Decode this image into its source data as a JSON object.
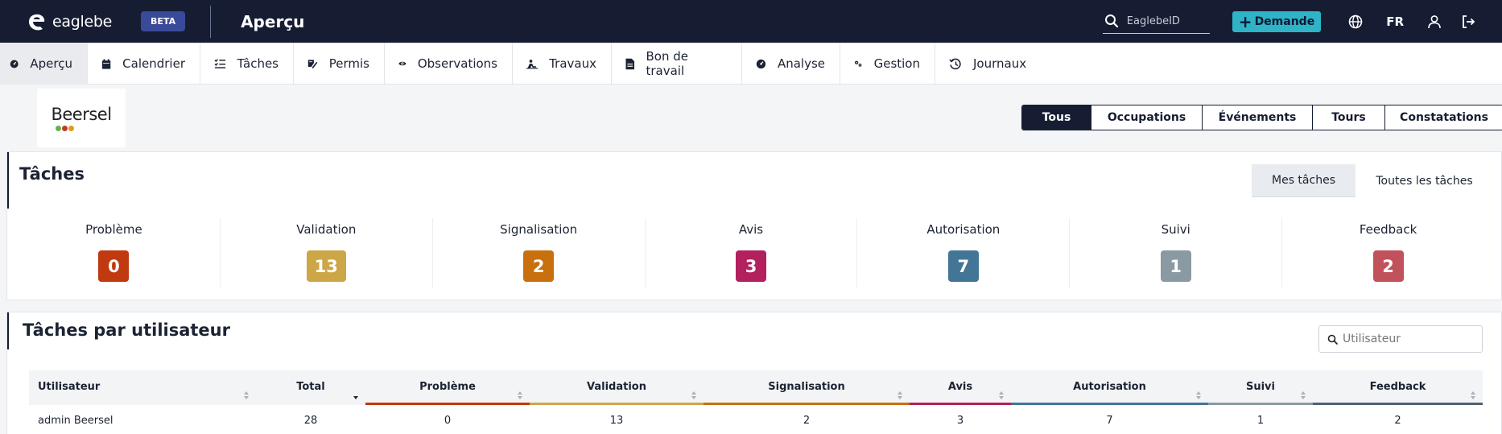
{
  "app": {
    "brand": "eaglebe",
    "beta_label": "BETA",
    "page_title": "Aperçu",
    "search_placeholder": "EaglebeID",
    "request_button": "Demande",
    "language": "FR"
  },
  "nav": {
    "items": [
      {
        "label": "Aperçu",
        "icon": "dashboard-icon",
        "active": true
      },
      {
        "label": "Calendrier",
        "icon": "calendar-icon"
      },
      {
        "label": "Tâches",
        "icon": "checklist-icon"
      },
      {
        "label": "Permis",
        "icon": "permit-icon"
      },
      {
        "label": "Observations",
        "icon": "eye-icon"
      },
      {
        "label": "Travaux",
        "icon": "worker-icon"
      },
      {
        "label": "Bon de travail",
        "icon": "document-icon"
      },
      {
        "label": "Analyse",
        "icon": "analysis-icon"
      },
      {
        "label": "Gestion",
        "icon": "gears-icon"
      },
      {
        "label": "Journaux",
        "icon": "history-icon"
      }
    ]
  },
  "municipality": {
    "name": "Beersel",
    "dot_colors": [
      "#6ab04c",
      "#c0392b",
      "#e39a1a"
    ]
  },
  "filters": {
    "items": [
      "Tous",
      "Occupations",
      "Événements",
      "Tours",
      "Constatations"
    ],
    "active": "Tous"
  },
  "tasks_panel": {
    "title": "Tâches",
    "toggle": {
      "mine": "Mes tâches",
      "all": "Toutes les tâches",
      "active": "mine"
    },
    "stats": [
      {
        "label": "Problème",
        "value": "0",
        "color": "#c0390f"
      },
      {
        "label": "Validation",
        "value": "13",
        "color": "#cda647"
      },
      {
        "label": "Signalisation",
        "value": "2",
        "color": "#c8700d"
      },
      {
        "label": "Avis",
        "value": "3",
        "color": "#b3205e"
      },
      {
        "label": "Autorisation",
        "value": "7",
        "color": "#437596"
      },
      {
        "label": "Suivi",
        "value": "1",
        "color": "#8a9aa3"
      },
      {
        "label": "Feedback",
        "value": "2",
        "color": "#c1525c"
      }
    ]
  },
  "user_panel": {
    "title": "Tâches par utilisateur",
    "search_placeholder": "Utilisateur",
    "columns": [
      {
        "label": "Utilisateur",
        "align": "left"
      },
      {
        "label": "Total",
        "sorted": "desc"
      },
      {
        "label": "Problème",
        "color": "#c0390f"
      },
      {
        "label": "Validation",
        "color": "#cda647"
      },
      {
        "label": "Signalisation",
        "color": "#c8700d"
      },
      {
        "label": "Avis",
        "color": "#b3205e"
      },
      {
        "label": "Autorisation",
        "color": "#437596"
      },
      {
        "label": "Suivi",
        "color": "#8a9aa3"
      },
      {
        "label": "Feedback",
        "color": "#50616d"
      }
    ],
    "rows": [
      [
        "admin Beersel",
        "28",
        "0",
        "13",
        "2",
        "3",
        "7",
        "1",
        "2"
      ]
    ]
  }
}
